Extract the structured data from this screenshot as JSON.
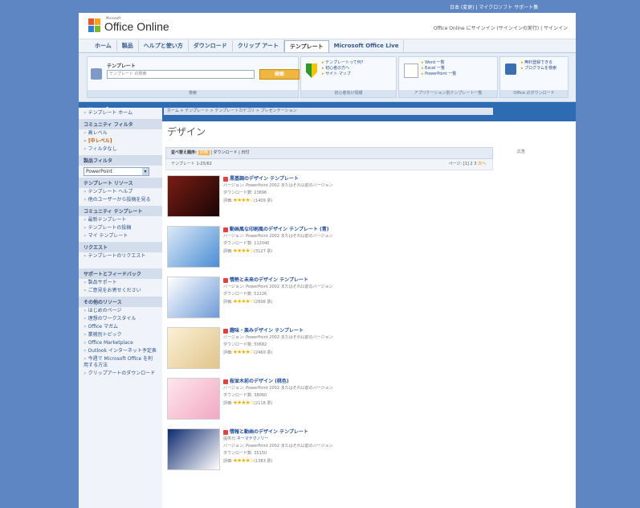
{
  "top_links": "日本 (変更) | マイクロソフト サポート集",
  "header": {
    "brand_small": "Microsoft",
    "brand": "Office Online",
    "signin": "Office Online にサインイン (サインインの実行) | サインイン"
  },
  "nav": {
    "tabs": [
      "ホーム",
      "製品",
      "ヘルプと使い方",
      "ダウンロード",
      "クリップ アート",
      "テンプレート",
      "Microsoft Office Live"
    ],
    "active": 5
  },
  "search": {
    "label": "テンプレート",
    "placeholder": "テンプレート の検索",
    "button": "検索",
    "foot": "検索"
  },
  "panels": [
    {
      "items": [
        "テンプレートって何?",
        "初心者の方へ",
        "サイト マップ"
      ],
      "foot": "初心者向け情報"
    },
    {
      "items": [
        "Word 一覧",
        "Excel 一覧",
        "PowerPoint 一覧"
      ],
      "foot": "アプリケーション別テンプレート一覧"
    },
    {
      "items": [
        "無料登録できる",
        "プログラムを検索"
      ],
      "foot": "Office のダウンロード"
    }
  ],
  "banner": "テンプレート",
  "sidebar": {
    "home": "テンプレート ホーム",
    "community_head": "コミュニティ フィルタ",
    "community_items": [
      "高レベル",
      "[中レベル]",
      "フィルタなし"
    ],
    "product_head": "製品フィルタ",
    "product_select": "PowerPoint",
    "resource_head": "テンプレート リソース",
    "resource_items": [
      "テンプレート ヘルプ",
      "他のユーザーから投稿を見る"
    ],
    "community_tpl_head": "コミュニティ テンプレート",
    "community_tpl_items": [
      "最新テンプレート",
      "テンプレートの投稿",
      "マイ テンプレート"
    ],
    "request_head": "リクエスト",
    "request_items": [
      "テンプレートのリクエスト"
    ],
    "support_head": "サポートとフィードバック",
    "support_items": [
      "製品サポート",
      "ご意見をお寄せください"
    ],
    "other_head": "その他のリソース",
    "other_items": [
      "はじめのページ",
      "理想のワークスタイル",
      "Office マガム",
      "業務別トピック",
      "Office Marketplace",
      "Outlook インターネット予定表",
      "今週で Microsoft Office を利用する方法",
      "クリップアートのダウンロード"
    ]
  },
  "breadcrumb": "ホーム > テンプレート > テンプレートカテゴリ > プレゼンテーション",
  "page_title": "デザイン",
  "filter": {
    "prefix": "並べ替え順序:",
    "selected": "評価",
    "rest": "| ダウンロード | 日付"
  },
  "count": "テンプレート 1-25/62",
  "pager": {
    "label": "ページ:",
    "pages": "[1] 2 3",
    "next": "次へ"
  },
  "right_label": "広告",
  "templates": [
    {
      "title": "黒基調のデザイン テンプレート",
      "version": "バージョン: PowerPoint 2002 またはそれ以前のバージョン",
      "downloads": "ダウンロード数: 23896",
      "rating_label": "評価:",
      "stars": 4,
      "votes": "(1409 票)",
      "colors": [
        "#7a1d14",
        "#1a0504"
      ]
    },
    {
      "title": "動画風な印刷風のデザイン テンプレート (青)",
      "version": "バージョン: PowerPoint 2002 またはそれ以前のバージョン",
      "downloads": "ダウンロード数: 112040",
      "rating_label": "評価:",
      "stars": 4,
      "votes": "(3127 票)",
      "colors": [
        "#dbe9f8",
        "#4b8dd4"
      ]
    },
    {
      "title": "情熱と未来のデザイン テンプレート",
      "version": "バージョン: PowerPoint 2002 またはそれ以前のバージョン",
      "downloads": "ダウンロード数: 52126",
      "rating_label": "評価:",
      "stars": 4,
      "votes": "(2698 票)",
      "colors": [
        "#ffffff",
        "#6f9bd8"
      ]
    },
    {
      "title": "趣味・楽みデザイン テンプレート",
      "version": "バージョン: PowerPoint 2002 またはそれ以前のバージョン",
      "downloads": "ダウンロード数: 50682",
      "rating_label": "評価:",
      "stars": 4,
      "votes": "(2460 票)",
      "colors": [
        "#fbf1d6",
        "#e0c48a"
      ]
    },
    {
      "title": "桜並木前のデザイン (桃色)",
      "version": "バージョン: PowerPoint 2002 またはそれ以前のバージョン",
      "downloads": "ダウンロード数: 38060",
      "rating_label": "評価:",
      "stars": 4,
      "votes": "(2118 票)",
      "colors": [
        "#fde6ee",
        "#f2a8c2"
      ]
    },
    {
      "title": "情報と動画のデザイン テンプレート",
      "author_label": "提供元:",
      "author": "ネーマテクノリー",
      "version": "バージョン: PowerPoint 2002 またはそれ以前のバージョン",
      "downloads": "ダウンロード数: 35150",
      "rating_label": "評価:",
      "stars": 4,
      "votes": "(1383 票)",
      "colors": [
        "#0e2a6e",
        "#ffffff"
      ]
    }
  ]
}
